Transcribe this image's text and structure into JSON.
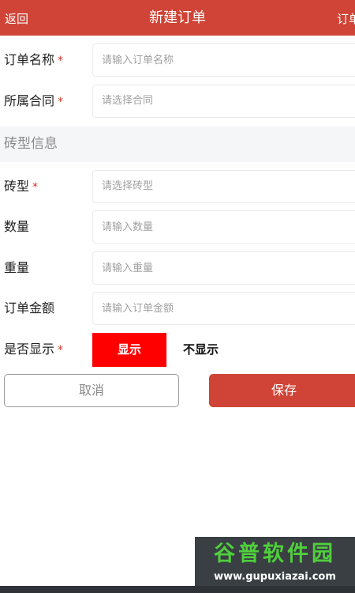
{
  "header": {
    "back_label": "返回",
    "title": "新建订单",
    "right_label": "订单"
  },
  "form": {
    "order_name": {
      "label": "订单名称",
      "required_mark": "*",
      "placeholder": "请输入订单名称"
    },
    "contract": {
      "label": "所属合同",
      "required_mark": "*",
      "placeholder": "请选择合同"
    },
    "section_title": "砖型信息",
    "brick_type": {
      "label": "砖型",
      "required_mark": "*",
      "placeholder": "请选择砖型"
    },
    "quantity": {
      "label": "数量",
      "placeholder": "请输入数量"
    },
    "weight": {
      "label": "重量",
      "placeholder": "请输入重量"
    },
    "amount": {
      "label": "订单金额",
      "placeholder": "请输入订单金额"
    },
    "display": {
      "label": "是否显示",
      "required_mark": "*",
      "option_show": "显示",
      "option_hide": "不显示",
      "selected": "显示"
    }
  },
  "actions": {
    "cancel_label": "取消",
    "save_label": "保存"
  },
  "watermark": {
    "name": "谷普软件园",
    "url": "www.gupuxiazai.com"
  },
  "colors": {
    "primary": "#cf4436",
    "selected_option": "#ff0000",
    "required": "#d0392b"
  }
}
